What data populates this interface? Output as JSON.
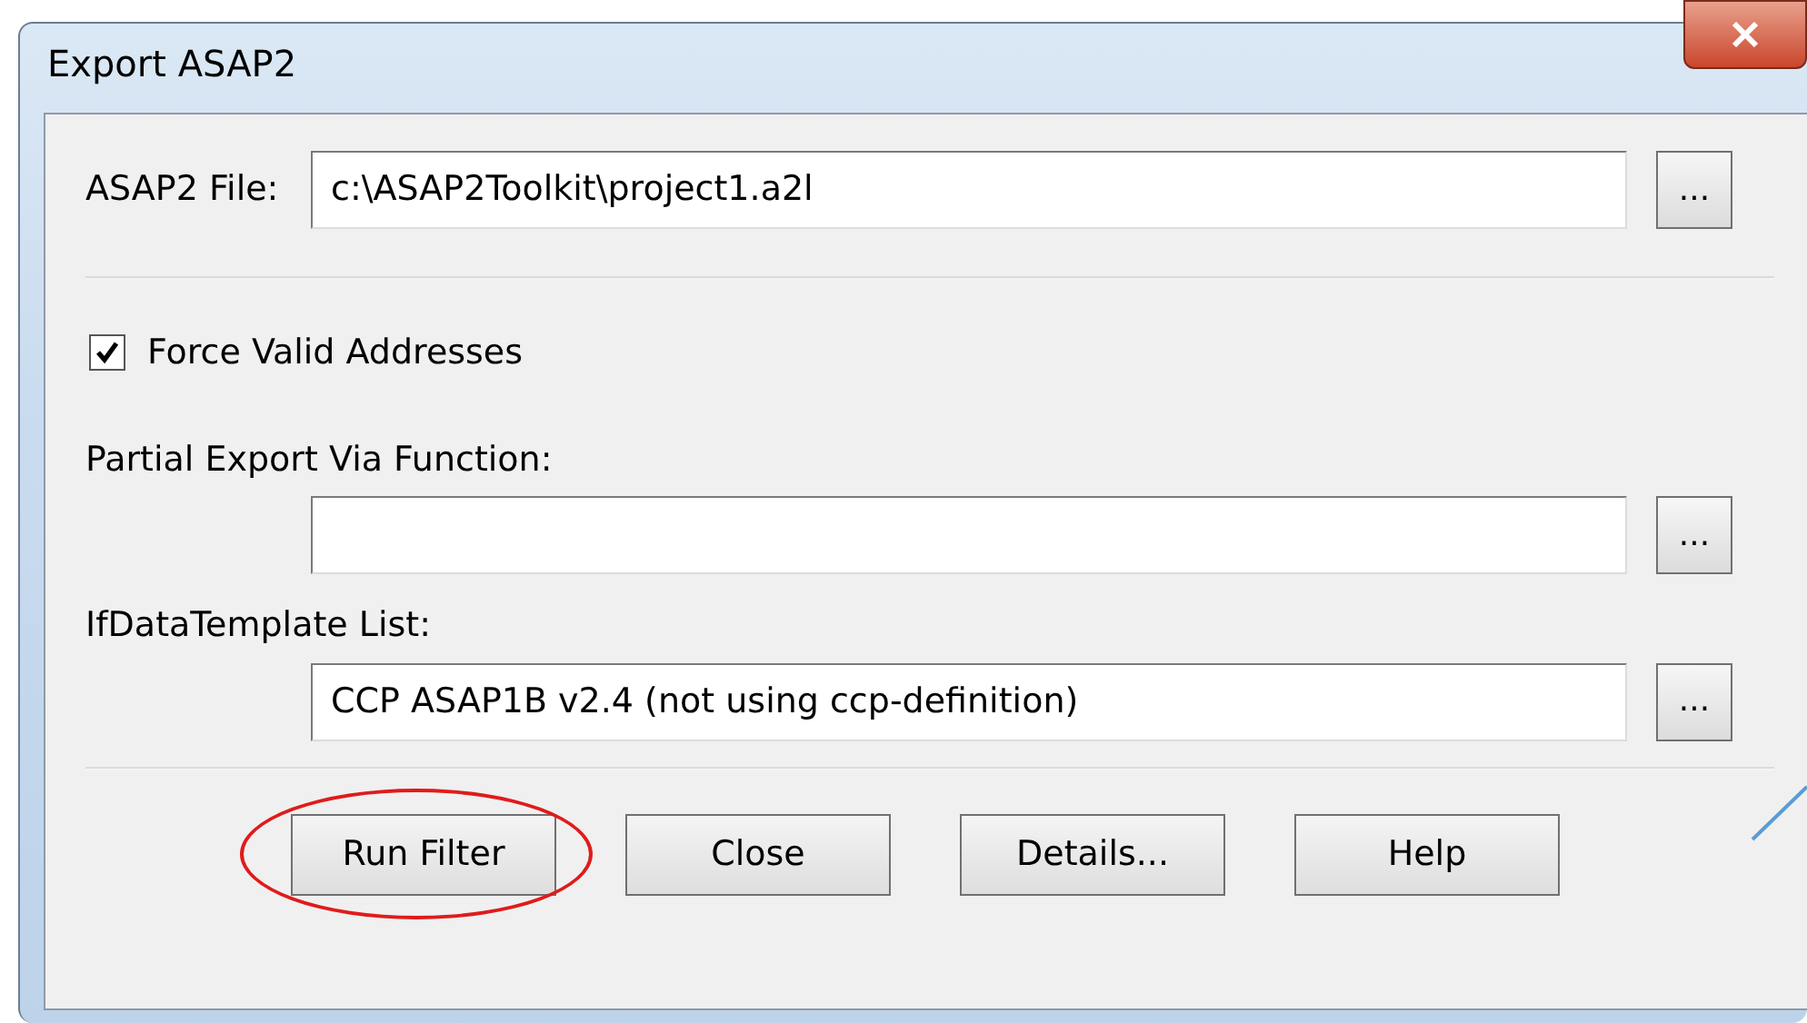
{
  "window": {
    "title": "Export ASAP2"
  },
  "rows": [
    {
      "kind": "field",
      "label": "ASAP2 File:",
      "value": "c:\\ASAP2Toolkit\\project1.a2l",
      "browse": "...",
      "separator_after": true
    },
    {
      "kind": "checkbox",
      "label": "Force Valid Addresses",
      "checked": true
    },
    {
      "kind": "stacked_field",
      "label": "Partial Export Via Function:",
      "browse": "..."
    },
    {
      "kind": "stacked_field",
      "label": "IfDataTemplate List:",
      "value": "CCP ASAP1B v2.4 (not using ccp-definition)",
      "browse": "...",
      "separator_after": true
    }
  ],
  "buttons": [
    {
      "label": "Run Filter",
      "circled": true
    },
    {
      "label": "Close",
      "circled": false
    },
    {
      "label": "Details...",
      "circled": false
    },
    {
      "label": "Help",
      "circled": false
    }
  ]
}
